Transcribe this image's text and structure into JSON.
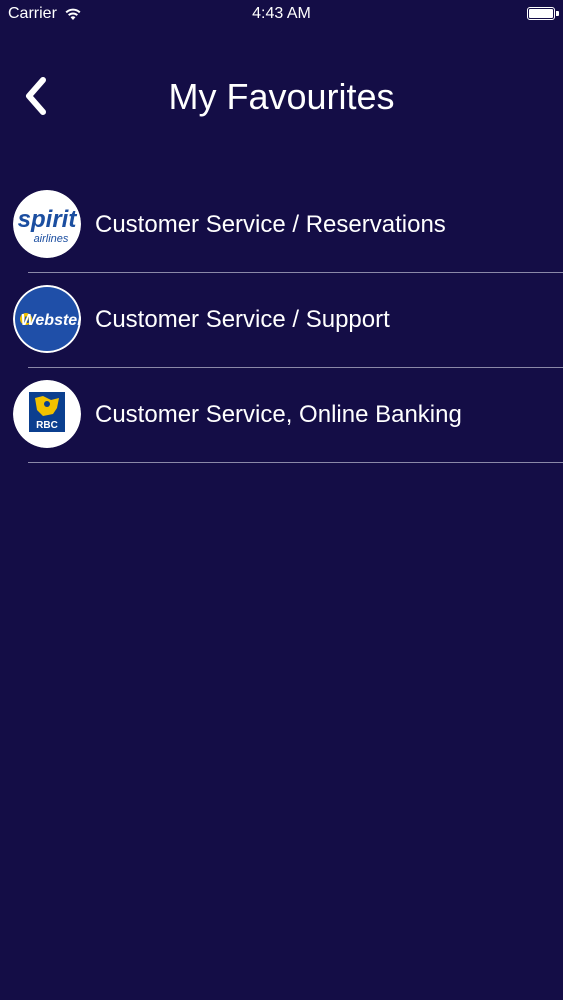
{
  "status_bar": {
    "carrier": "Carrier",
    "time": "4:43 AM",
    "wifi_icon": "wifi-icon",
    "battery_icon": "battery-icon",
    "battery_level": 1.0
  },
  "nav": {
    "back_icon": "chevron-left-icon",
    "title": "My Favourites"
  },
  "favorites": [
    {
      "label": "Customer Service / Reservations",
      "logo": "spirit-airlines-logo",
      "logo_text": "spirit",
      "logo_subtext": "airlines"
    },
    {
      "label": "Customer Service / Support",
      "logo": "webster-bank-logo",
      "logo_text": "Webster"
    },
    {
      "label": "Customer Service, Online Banking",
      "logo": "rbc-logo",
      "logo_text": "RBC"
    }
  ],
  "colors": {
    "background": "#140d46",
    "text": "#ffffff",
    "divider": "#8b88a8",
    "spirit_blue": "#1b4ea0",
    "webster_blue": "#1f4fa8",
    "rbc_blue": "#0b3f8f",
    "rbc_gold": "#f2c200"
  }
}
